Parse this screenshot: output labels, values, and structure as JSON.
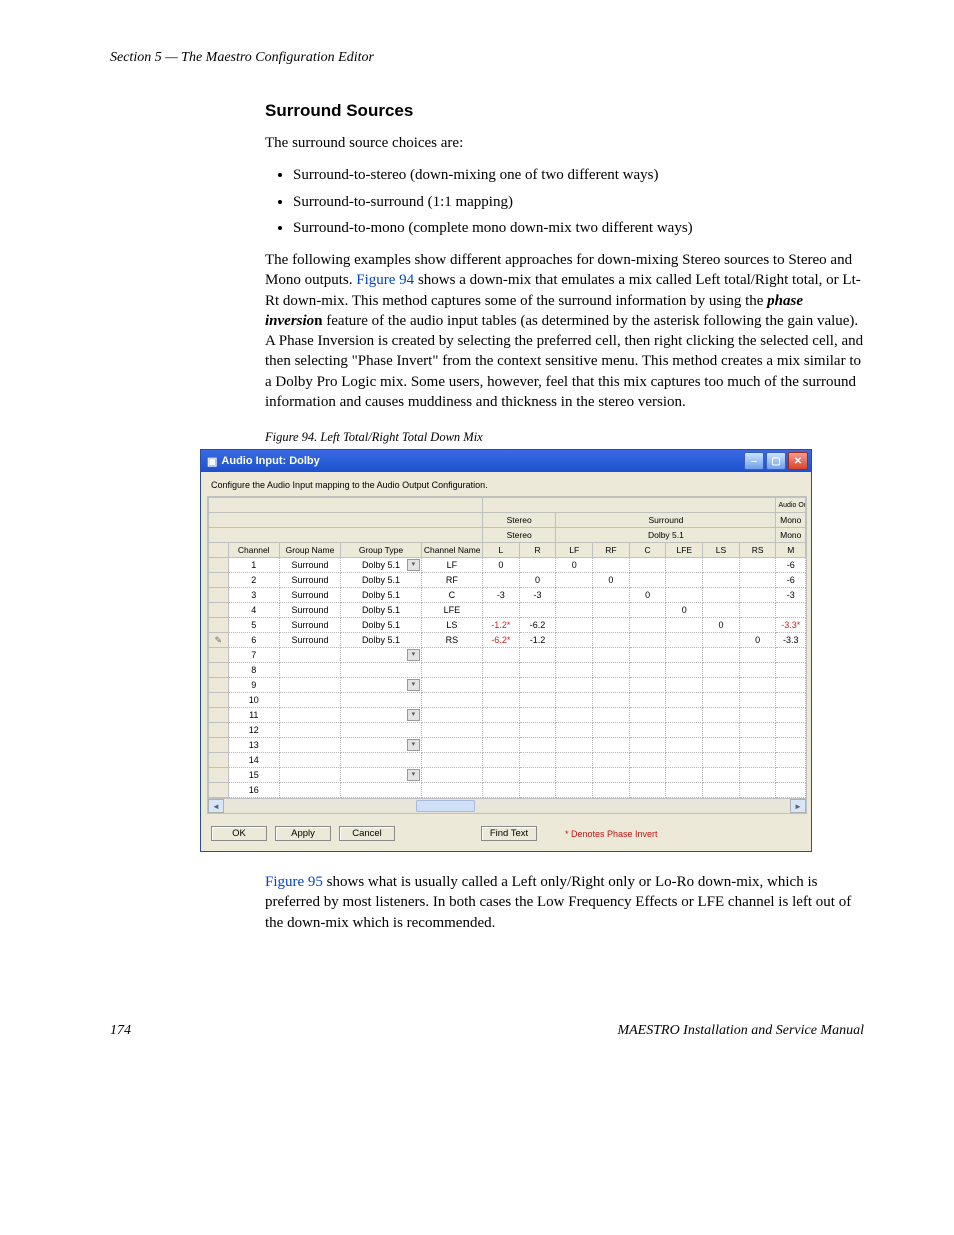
{
  "header": {
    "section": "Section 5 — The Maestro Configuration Editor"
  },
  "heading": "Surround Sources",
  "intro": "The surround source choices are:",
  "bullets": [
    "Surround-to-stereo (down-mixing one of two different ways)",
    "Surround-to-surround (1:1 mapping)",
    "Surround-to-mono (complete mono down-mix two different ways)"
  ],
  "para1a": "The following examples show different approaches for down-mixing Stereo sources to Stereo and Mono outputs. ",
  "para1_link": "Figure 94",
  "para1b": " shows a down-mix that emulates a mix called Left total/Right total, or Lt-Rt down-mix. This method captures some of the surround information by using the ",
  "para1_em": "phase inversio",
  "para1_bold": "n",
  "para1c": " feature of the audio input tables (as determined by the asterisk following the gain value). A Phase Inversion is created by selecting the preferred cell, then right clicking the selected cell, and then selecting \"Phase Invert\" from the context sensitive menu. This method creates a mix similar to a Dolby Pro Logic mix. Some users, however, feel that this mix captures too much of the surround information and causes muddiness and thickness in the stereo version.",
  "fig_caption": "Figure 94.  Left Total/Right Total Down Mix",
  "window": {
    "title": "Audio Input: Dolby",
    "instruction": "Configure the Audio Input mapping to the Audio Output Configuration.",
    "top_header_right": "Audio Output Configuration",
    "group_labels": {
      "stereo": "Stereo",
      "surround": "Surround",
      "mono": "Mono",
      "dolby": "Dolby 5.1"
    },
    "cols": {
      "channel": "Channel",
      "group_name": "Group Name",
      "group_type": "Group Type",
      "channel_name": "Channel Name",
      "L": "L",
      "R": "R",
      "LF": "LF",
      "RF": "RF",
      "C": "C",
      "LFE": "LFE",
      "LS": "LS",
      "RS": "RS",
      "M": "M"
    },
    "rows": [
      {
        "ch": "1",
        "gn": "Surround",
        "gt": "Dolby 5.1",
        "dd": true,
        "cn": "LF",
        "L": "0",
        "R": "",
        "LF": "0",
        "RF": "",
        "C": "",
        "LFE": "",
        "LS": "",
        "RS": "",
        "M": "-6"
      },
      {
        "ch": "2",
        "gn": "Surround",
        "gt": "Dolby 5.1",
        "cn": "RF",
        "L": "",
        "R": "0",
        "LF": "",
        "RF": "0",
        "C": "",
        "LFE": "",
        "LS": "",
        "RS": "",
        "M": "-6"
      },
      {
        "ch": "3",
        "gn": "Surround",
        "gt": "Dolby 5.1",
        "cn": "C",
        "L": "-3",
        "R": "-3",
        "LF": "",
        "RF": "",
        "C": "0",
        "LFE": "",
        "LS": "",
        "RS": "",
        "M": "-3"
      },
      {
        "ch": "4",
        "gn": "Surround",
        "gt": "Dolby 5.1",
        "cn": "LFE",
        "L": "",
        "R": "",
        "LF": "",
        "RF": "",
        "C": "",
        "LFE": "0",
        "LS": "",
        "RS": "",
        "M": ""
      },
      {
        "ch": "5",
        "gn": "Surround",
        "gt": "Dolby 5.1",
        "cn": "LS",
        "L": "-1.2*",
        "Lred": true,
        "R": "-6.2",
        "LF": "",
        "RF": "",
        "C": "",
        "LFE": "",
        "LS": "0",
        "RS": "",
        "M": "-3.3*",
        "Mred": true
      },
      {
        "ch": "6",
        "gn": "Surround",
        "gt": "Dolby 5.1",
        "cn": "RS",
        "pencil": true,
        "L": "-6.2*",
        "Lred": true,
        "R": "-1.2",
        "LF": "",
        "RF": "",
        "C": "",
        "LFE": "",
        "LS": "",
        "RS": "0",
        "M": "-3.3"
      },
      {
        "ch": "7",
        "dd": true
      },
      {
        "ch": "8"
      },
      {
        "ch": "9",
        "dd": true
      },
      {
        "ch": "10"
      },
      {
        "ch": "11",
        "dd": true
      },
      {
        "ch": "12"
      },
      {
        "ch": "13",
        "dd": true
      },
      {
        "ch": "14"
      },
      {
        "ch": "15",
        "dd": true
      },
      {
        "ch": "16"
      }
    ],
    "buttons": {
      "ok": "OK",
      "apply": "Apply",
      "cancel": "Cancel",
      "find": "Find Text"
    },
    "note": "* Denotes Phase Invert"
  },
  "para2_link": "Figure 95",
  "para2": " shows what is usually called a Left only/Right only or Lo-Ro down-mix, which is preferred by most listeners. In both cases the Low Frequency Effects or LFE channel is left out of the down-mix which is recommended.",
  "footer": {
    "page": "174",
    "manual": "MAESTRO Installation and Service Manual"
  }
}
